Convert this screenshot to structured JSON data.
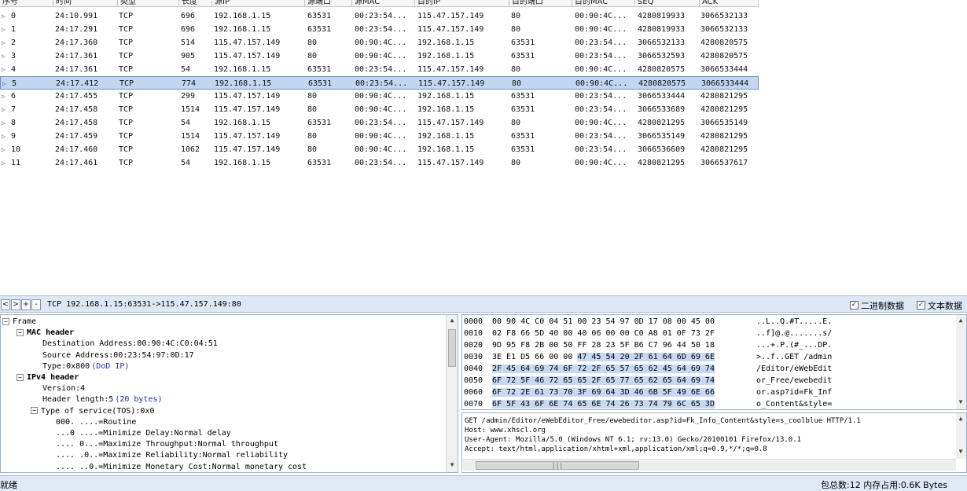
{
  "columns": [
    "序号",
    "时间",
    "类型",
    "长度",
    "源IP",
    "源端口",
    "源MAC",
    "目的IP",
    "目的端口",
    "目的MAC",
    "SEQ",
    "ACK"
  ],
  "packets": [
    [
      "0",
      "24:10.991",
      "TCP",
      "696",
      "192.168.1.15",
      "63531",
      "00:23:54...",
      "115.47.157.149",
      "80",
      "00:90:4C...",
      "4280819933",
      "3066532133"
    ],
    [
      "1",
      "24:17.291",
      "TCP",
      "696",
      "192.168.1.15",
      "63531",
      "00:23:54...",
      "115.47.157.149",
      "80",
      "00:90:4C...",
      "4280819933",
      "3066532133"
    ],
    [
      "2",
      "24:17.360",
      "TCP",
      "514",
      "115.47.157.149",
      "80",
      "00:90:4C...",
      "192.168.1.15",
      "63531",
      "00:23:54...",
      "3066532133",
      "4280820575"
    ],
    [
      "3",
      "24:17.361",
      "TCP",
      "905",
      "115.47.157.149",
      "80",
      "00:90:4C...",
      "192.168.1.15",
      "63531",
      "00:23:54...",
      "3066532593",
      "4280820575"
    ],
    [
      "4",
      "24:17.361",
      "TCP",
      "54",
      "192.168.1.15",
      "63531",
      "00:23:54...",
      "115.47.157.149",
      "80",
      "00:90:4C...",
      "4280820575",
      "3066533444"
    ],
    [
      "5",
      "24:17.412",
      "TCP",
      "774",
      "192.168.1.15",
      "63531",
      "00:23:54...",
      "115.47.157.149",
      "80",
      "00:90:4C...",
      "4280820575",
      "3066533444"
    ],
    [
      "6",
      "24:17.455",
      "TCP",
      "299",
      "115.47.157.149",
      "80",
      "00:90:4C...",
      "192.168.1.15",
      "63531",
      "00:23:54...",
      "3066533444",
      "4280821295"
    ],
    [
      "7",
      "24:17.458",
      "TCP",
      "1514",
      "115.47.157.149",
      "80",
      "00:90:4C...",
      "192.168.1.15",
      "63531",
      "00:23:54...",
      "3066533689",
      "4280821295"
    ],
    [
      "8",
      "24:17.458",
      "TCP",
      "54",
      "192.168.1.15",
      "63531",
      "00:23:54...",
      "115.47.157.149",
      "80",
      "00:90:4C...",
      "4280821295",
      "3066535149"
    ],
    [
      "9",
      "24:17.459",
      "TCP",
      "1514",
      "115.47.157.149",
      "80",
      "00:90:4C...",
      "192.168.1.15",
      "63531",
      "00:23:54...",
      "3066535149",
      "4280821295"
    ],
    [
      "10",
      "24:17.460",
      "TCP",
      "1062",
      "115.47.157.149",
      "80",
      "00:90:4C...",
      "192.168.1.15",
      "63531",
      "00:23:54...",
      "3066536609",
      "4280821295"
    ],
    [
      "11",
      "24:17.461",
      "TCP",
      "54",
      "192.168.1.15",
      "63531",
      "00:23:54...",
      "115.47.157.149",
      "80",
      "00:90:4C...",
      "4280821295",
      "3066537617"
    ]
  ],
  "selected_row": 5,
  "toolbar": {
    "btn_prev": "<",
    "btn_next": ">",
    "btn_plus": "+",
    "btn_minus": "-",
    "title": "TCP 192.168.1.15:63531->115.47.157.149:80",
    "binary_label": "二进制数据",
    "text_label": "文本数据",
    "checkmark": "✓"
  },
  "tree": [
    {
      "depth": 0,
      "box": "−",
      "label": "Frame",
      "bold": false,
      "note": ""
    },
    {
      "depth": 1,
      "box": "−",
      "label": "MAC header",
      "bold": true,
      "note": ""
    },
    {
      "depth": 2,
      "box": "",
      "label": "Destination Address:00:90:4C:C0:04:51",
      "bold": false,
      "note": ""
    },
    {
      "depth": 2,
      "box": "",
      "label": "Source Address:00:23:54:97:0D:17",
      "bold": false,
      "note": ""
    },
    {
      "depth": 2,
      "box": "",
      "label": "Type:0x800",
      "bold": false,
      "note": "(DoD IP)"
    },
    {
      "depth": 1,
      "box": "−",
      "label": "IPv4 header",
      "bold": true,
      "note": ""
    },
    {
      "depth": 2,
      "box": "",
      "label": "Version:4",
      "bold": false,
      "note": ""
    },
    {
      "depth": 2,
      "box": "",
      "label": "Header length:5",
      "bold": false,
      "note": "(20 bytes)"
    },
    {
      "depth": 2,
      "box": "−",
      "label": "Type of service(TOS):0x0",
      "bold": false,
      "note": ""
    },
    {
      "depth": 3,
      "box": "",
      "label": "000. ....=Routine",
      "bold": false,
      "note": ""
    },
    {
      "depth": 3,
      "box": "",
      "label": "...0 ....=Minimize Delay:Normal delay",
      "bold": false,
      "note": ""
    },
    {
      "depth": 3,
      "box": "",
      "label": ".... 0...=Maximize Throughput:Normal throughput",
      "bold": false,
      "note": ""
    },
    {
      "depth": 3,
      "box": "",
      "label": ".... .0..=Maximize Reliability:Normal reliability",
      "bold": false,
      "note": ""
    },
    {
      "depth": 3,
      "box": "",
      "label": ".... ..0.=Minimize Monetary Cost:Normal monetary cost",
      "bold": false,
      "note": ""
    }
  ],
  "hex": [
    {
      "off": "0000",
      "pre": "00 90 4C C0 04 51 00 23 54 97 0D 17 08 00 45 00",
      "hl": "",
      "ascii": "..L..Q.#T.....E."
    },
    {
      "off": "0010",
      "pre": "02 F8 66 5D 40 00 40 06 00 00 C0 A8 01 0F 73 2F",
      "hl": "",
      "ascii": "..f]@.@.......s/"
    },
    {
      "off": "0020",
      "pre": "9D 95 F8 2B 00 50 FF 28 23 5F B6 C7 96 44 50 18",
      "hl": "",
      "ascii": "...+.P.(#_...DP."
    },
    {
      "off": "0030",
      "pre": "3E E1 D5 66 00 00 ",
      "hl": "47 45 54 20 2F 61 64 6D 69 6E",
      "ascii": ">..f..GET /admin"
    },
    {
      "off": "0040",
      "pre": "",
      "hl": "2F 45 64 69 74 6F 72 2F 65 57 65 62 45 64 69 74",
      "ascii": "/Editor/eWebEdit"
    },
    {
      "off": "0050",
      "pre": "",
      "hl": "6F 72 5F 46 72 65 65 2F 65 77 65 62 65 64 69 74",
      "ascii": "or_Free/ewebedit"
    },
    {
      "off": "0060",
      "pre": "",
      "hl": "6F 72 2E 61 73 70 3F 69 64 3D 46 6B 5F 49 6E 66",
      "ascii": "or.asp?id=Fk_Inf"
    },
    {
      "off": "0070",
      "pre": "",
      "hl": "6F 5F 43 6F 6E 74 65 6E 74 26 73 74 79 6C 65 3D",
      "ascii": "o_Content&style="
    }
  ],
  "text_lines": [
    "GET /admin/Editor/eWebEditor_Free/ewebeditor.asp?id=Fk_Info_Content&style=s_coolblue HTTP/1.1",
    "Host: www.xhscl.org",
    "User-Agent: Mozilla/5.0 (Windows NT 6.1; rv:13.0) Gecko/20100101 Firefox/13.0.1",
    "Accept: text/html,application/xhtml+xml,application/xml;q=0.9,*/*;q=0.8"
  ],
  "status": {
    "left": "就绪",
    "right": "包总数:12 内存占用:0.6K Bytes"
  },
  "icons": {
    "scroll_up": "▲",
    "scroll_down": "▼",
    "expander": "▷",
    "grip": "|||"
  },
  "colors": {
    "selection_bg": "#c3d6f0",
    "hex_highlight": "#c7d8f2",
    "panel_bg": "#dde8f6",
    "note_blue": "#1c2fb0"
  }
}
